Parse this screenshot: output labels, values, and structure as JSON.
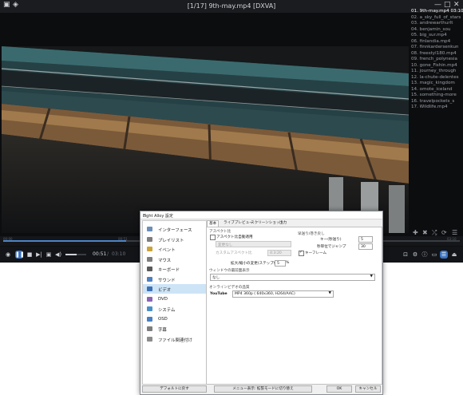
{
  "window": {
    "title": "[1/17] 9th-may.mp4 [DXVA]",
    "minimize": "—",
    "maximize": "□",
    "close": "✕"
  },
  "playlist": {
    "items": [
      {
        "label": "01. 9th-may.mp4 03:10",
        "active": true
      },
      {
        "label": "02. a_sky_full_of_stars",
        "active": false
      },
      {
        "label": "03. andrewarthurlt",
        "active": false
      },
      {
        "label": "04. benjamin_sou",
        "active": false
      },
      {
        "label": "05. big_sur.mp4",
        "active": false
      },
      {
        "label": "06. finlandia.mp4",
        "active": false
      },
      {
        "label": "07. finnkardersenkun",
        "active": false
      },
      {
        "label": "08. freestyl180.mp4",
        "active": false
      },
      {
        "label": "09. french_polynesia",
        "active": false
      },
      {
        "label": "10. gone_Fishin.mp4",
        "active": false
      },
      {
        "label": "11. journey_through",
        "active": false
      },
      {
        "label": "12. la-chute-delentes",
        "active": false
      },
      {
        "label": "13. magic_kingdom",
        "active": false
      },
      {
        "label": "14. omote_iceland",
        "active": false
      },
      {
        "label": "15. something-more",
        "active": false
      },
      {
        "label": "16. travelpockets_s",
        "active": false
      },
      {
        "label": "17. Wildlife.mp4",
        "active": false
      }
    ]
  },
  "timeline": {
    "progress": 0.27,
    "left_label": "00:00",
    "mid_label": "00:51",
    "right_label": "03:10"
  },
  "controls": {
    "current_time": "00:51",
    "total_time": "03:10",
    "volume": 0.55
  },
  "dialog": {
    "title": "Light Alloy 設定",
    "close": "✕",
    "sidebar": [
      {
        "label": "インターフェース",
        "icon": "interface-icon",
        "color": "#6b8fb8",
        "active": false
      },
      {
        "label": "プレイリスト",
        "icon": "playlist-icon",
        "color": "#7d7d7d",
        "active": false
      },
      {
        "label": "イベント",
        "icon": "event-icon",
        "color": "#c9a43a",
        "active": false
      },
      {
        "label": "マウス",
        "icon": "mouse-icon",
        "color": "#7d7d7d",
        "active": false
      },
      {
        "label": "キーボード",
        "icon": "keyboard-icon",
        "color": "#5a5a5a",
        "active": false
      },
      {
        "label": "サウンド",
        "icon": "sound-icon",
        "color": "#4f7fc1",
        "active": false
      },
      {
        "label": "ビデオ",
        "icon": "video-icon",
        "color": "#3d6fb3",
        "active": true
      },
      {
        "label": "DVD",
        "icon": "dvd-icon",
        "color": "#8a64b5",
        "active": false
      },
      {
        "label": "システム",
        "icon": "system-icon",
        "color": "#4a90c8",
        "active": false
      },
      {
        "label": "OSD",
        "icon": "osd-icon",
        "color": "#4a7fc0",
        "active": false
      },
      {
        "label": "字幕",
        "icon": "subtitle-icon",
        "color": "#7d7d7d",
        "active": false
      },
      {
        "label": "ファイル関連付け",
        "icon": "file-assoc-icon",
        "color": "#8b8b8b",
        "active": false
      }
    ],
    "tabs": [
      {
        "label": "基本",
        "active": true
      },
      {
        "label": "ライブプレビュー",
        "active": false
      },
      {
        "label": "スクリーンショット",
        "active": false
      },
      {
        "label": "出力",
        "active": false
      }
    ],
    "panel": {
      "aspect_group": "アスペクト比",
      "aspect_auto": "アスペクト比自動適用",
      "aspect_auto_checked": false,
      "aspect_value": "変更なし",
      "custom_aspect_label": "カスタムアスペクト比",
      "custom_aspect_value": "4:3:20",
      "rewind_group": "早送り/巻き戻し",
      "key_label": "キー(秒送り)",
      "key_value": "5",
      "jump_label": "秒単位でジャンプ",
      "jump_value": "30",
      "keyframe_label": "キーフレーム",
      "keyframe_checked": true,
      "scale_label": "拡大/縮小の変更(ステップ値)",
      "scale_value": "5",
      "scale_unit": "%",
      "fullscreen_label": "ウィンドウの最前面表示",
      "fullscreen_value": "なし",
      "online_group": "オンラインビデオの品質",
      "youtube_label": "YouTube",
      "youtube_value": "MP4    360p  ( 640x360,  H264/AAC)"
    },
    "buttons": {
      "defaults": "デフォルトに戻す",
      "menu": "メニュー表示: 拡張モードに切り替え",
      "ok": "OK",
      "cancel": "キャンセル"
    }
  }
}
